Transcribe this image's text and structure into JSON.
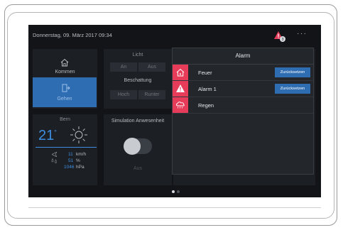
{
  "header": {
    "datetime": "Donnerstag, 09. März 2017 09:34",
    "alarm_badge_count": "3",
    "more_label": "···"
  },
  "tiles": {
    "kommen_label": "Kommen",
    "gehen_label": "Gehen",
    "licht": {
      "title": "Licht",
      "on_label": "An",
      "off_label": "Aus"
    },
    "beschattung": {
      "title": "Beschattung",
      "up_label": "Hoch",
      "down_label": "Runter"
    },
    "weather": {
      "city": "Bern",
      "temperature": "21",
      "temperature_unit": "°",
      "wind_value": "11",
      "wind_unit": "km/h",
      "humidity_value": "51",
      "humidity_unit": "%",
      "pressure_value": "1046",
      "pressure_unit": "hPa"
    },
    "simulation": {
      "title": "Simulation Anwesenheit",
      "state_label": "Aus"
    }
  },
  "alarm_popup": {
    "title": "Alarm",
    "items": [
      {
        "label": "Feuer",
        "icon": "house-fire-icon",
        "reset_label": "Zurücksetzen"
      },
      {
        "label": "Alarm 1",
        "icon": "warning-icon",
        "reset_label": "Zurücksetzen"
      },
      {
        "label": "Regen",
        "icon": "rain-cloud-icon"
      }
    ]
  },
  "colors": {
    "accent_blue": "#2f6db3",
    "alarm_red": "#e63c5a",
    "background": "#121417"
  },
  "pager": {
    "pages": 2,
    "current": 1
  }
}
